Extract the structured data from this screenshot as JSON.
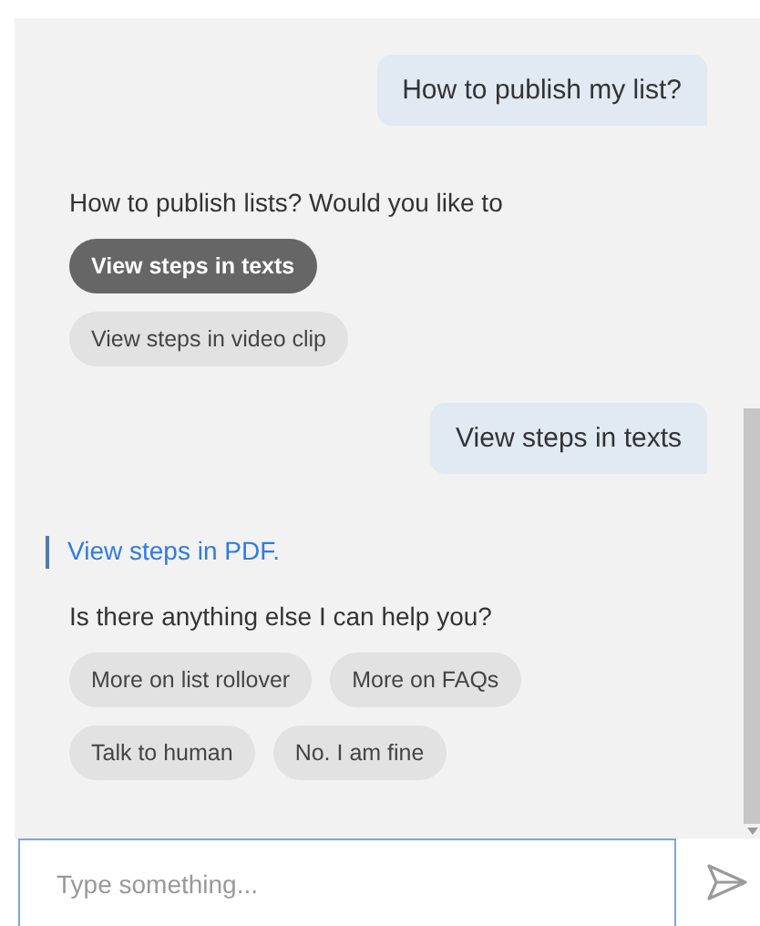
{
  "messages": [
    {
      "kind": "user",
      "text": "How to publish my list?"
    },
    {
      "kind": "bot",
      "text": "How to publish lists? Would you like to"
    },
    {
      "kind": "chips",
      "chips": [
        {
          "label": "View steps in texts",
          "selected": true
        },
        {
          "label": "View steps in video clip",
          "selected": false
        }
      ]
    },
    {
      "kind": "user",
      "text": "View steps in texts"
    },
    {
      "kind": "link",
      "text": "View steps in PDF."
    },
    {
      "kind": "bot",
      "text": "Is there anything else I can help you?"
    },
    {
      "kind": "chips",
      "chips": [
        {
          "label": "More on list rollover",
          "selected": false
        },
        {
          "label": "More on FAQs",
          "selected": false
        },
        {
          "label": "Talk to human",
          "selected": false
        },
        {
          "label": "No. I am fine",
          "selected": false
        }
      ]
    }
  ],
  "input": {
    "placeholder": "Type something..."
  }
}
